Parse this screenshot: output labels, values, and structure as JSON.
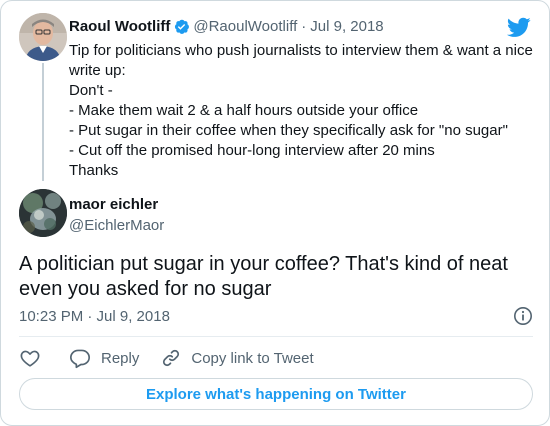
{
  "colors": {
    "accent": "#1d9bf0",
    "text": "#0f1419",
    "muted": "#536471",
    "border": "#cfd9de"
  },
  "parent_tweet": {
    "author_name": "Raoul Wootliff",
    "verified": true,
    "handle": "@RaoulWootliff",
    "separator": "·",
    "date": "Jul 9, 2018",
    "lines": [
      "Tip for politicians who push journalists to interview them & want a nice",
      "write up:",
      "Don't -",
      "- Make them wait 2 & a half hours outside your office",
      "- Put sugar in their coffee when they specifically ask for \"no sugar\"",
      "- Cut off the promised hour-long interview after 20 mins",
      "Thanks"
    ],
    "brand_icon": "twitter-bird-icon"
  },
  "reply_tweet": {
    "author_name": "maor eichler",
    "handle": "@EichlerMaor",
    "text_lines": [
      "A politician put sugar in your coffee? That's kind of neat",
      "even you asked for no sugar"
    ],
    "timestamp": "10:23 PM · Jul 9, 2018",
    "info_icon": "info-icon"
  },
  "actions": {
    "like_icon": "heart-icon",
    "reply_label": "Reply",
    "reply_icon": "comment-icon",
    "copy_label": "Copy link to Tweet",
    "copy_icon": "link-icon"
  },
  "footer": {
    "explore_label": "Explore what's happening on Twitter"
  }
}
